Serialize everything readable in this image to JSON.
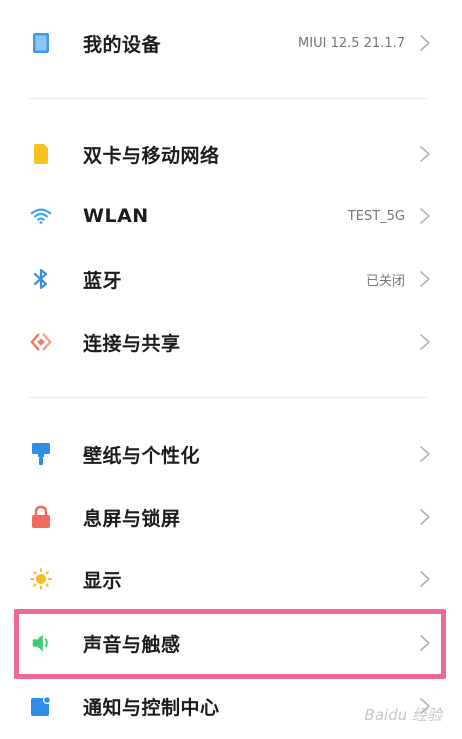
{
  "device": {
    "label": "我的设备",
    "value": "MIUI 12.5 21.1.7"
  },
  "network": [
    {
      "label": "双卡与移动网络",
      "value": ""
    },
    {
      "label": "WLAN",
      "value": "TEST_5G"
    },
    {
      "label": "蓝牙",
      "value": "已关闭"
    },
    {
      "label": "连接与共享",
      "value": ""
    }
  ],
  "display": [
    {
      "label": "壁纸与个性化",
      "value": ""
    },
    {
      "label": "息屏与锁屏",
      "value": ""
    },
    {
      "label": "显示",
      "value": ""
    },
    {
      "label": "声音与触感",
      "value": ""
    },
    {
      "label": "通知与控制中心",
      "value": ""
    }
  ],
  "icons": {
    "device": "tablet-icon",
    "sim": "sim-card-icon",
    "wlan": "wifi-icon",
    "bluetooth": "bluetooth-icon",
    "share": "share-connection-icon",
    "wallpaper": "paint-brush-icon",
    "lock": "lock-icon",
    "display": "sun-icon",
    "sound": "speaker-icon",
    "notification": "notification-icon"
  },
  "colors": {
    "device": "#3d9be9",
    "sim": "#f7c21b",
    "wlan": "#3ba6f0",
    "bluetooth": "#3b8fe0",
    "share": "#ef7b5a",
    "wallpaper": "#2f8fe8",
    "lock": "#f06b5b",
    "display": "#f6b928",
    "sound": "#3ecb73",
    "notification": "#2f8fe8",
    "highlight": "#ec6a92"
  },
  "watermark": "Baidu 经验"
}
